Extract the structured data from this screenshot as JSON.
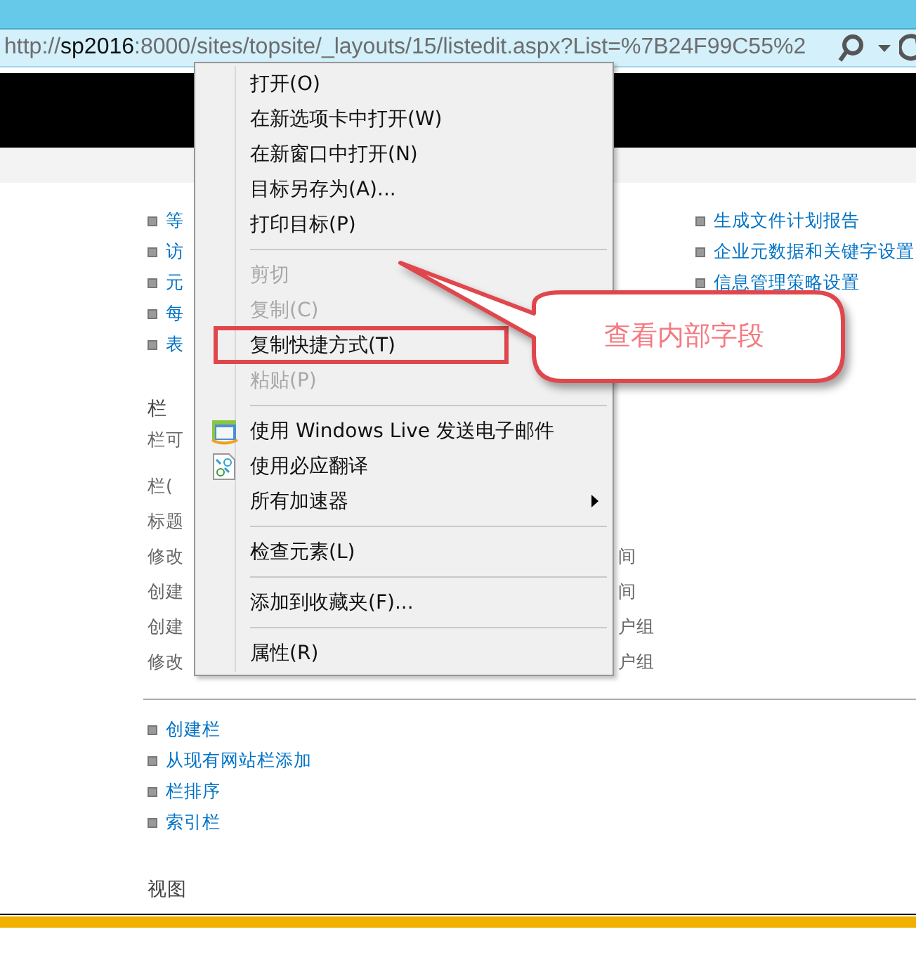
{
  "address_bar": {
    "scheme": "http://",
    "host": "sp2016",
    "path": ":8000/sites/topsite/_layouts/15/listedit.aspx?List=%7B24F99C55%2"
  },
  "left_links": [
    "等",
    "访",
    "元",
    "每",
    "表"
  ],
  "right_links": [
    "生成文件计划报告",
    "企业元数据和关键字设置",
    "信息管理策略设置"
  ],
  "columns_section": {
    "heading": "栏",
    "description": "栏可",
    "rows": [
      {
        "name": "栏("
      },
      {
        "name": "标题"
      },
      {
        "name": "修改",
        "type": "间"
      },
      {
        "name": "创建",
        "type": "间"
      },
      {
        "name": "创建",
        "type": "户组"
      },
      {
        "name": "修改",
        "type": "户组"
      }
    ]
  },
  "column_actions": [
    "创建栏",
    "从现有网站栏添加",
    "栏排序",
    "索引栏"
  ],
  "views_heading": "视图",
  "context_menu": {
    "items": [
      {
        "kind": "item",
        "label": "打开(O)",
        "disabled": false
      },
      {
        "kind": "item",
        "label": "在新选项卡中打开(W)",
        "disabled": false
      },
      {
        "kind": "item",
        "label": "在新窗口中打开(N)",
        "disabled": false
      },
      {
        "kind": "item",
        "label": "目标另存为(A)...",
        "disabled": false
      },
      {
        "kind": "item",
        "label": "打印目标(P)",
        "disabled": false
      },
      {
        "kind": "separator"
      },
      {
        "kind": "item",
        "label": "剪切",
        "disabled": true
      },
      {
        "kind": "item",
        "label": "复制(C)",
        "disabled": true
      },
      {
        "kind": "item",
        "label": "复制快捷方式(T)",
        "disabled": false
      },
      {
        "kind": "item",
        "label": "粘贴(P)",
        "disabled": true
      },
      {
        "kind": "separator"
      },
      {
        "kind": "email",
        "label": "使用 Windows Live 发送电子邮件",
        "disabled": false
      },
      {
        "kind": "translate",
        "label": "使用必应翻译",
        "disabled": false
      },
      {
        "kind": "submenu",
        "label": "所有加速器",
        "disabled": false
      },
      {
        "kind": "separator"
      },
      {
        "kind": "item",
        "label": "检查元素(L)",
        "disabled": false
      },
      {
        "kind": "separator"
      },
      {
        "kind": "item",
        "label": "添加到收藏夹(F)...",
        "disabled": false
      },
      {
        "kind": "separator"
      },
      {
        "kind": "item",
        "label": "属性(R)",
        "disabled": false
      }
    ]
  },
  "annotation": {
    "text": "查看内部字段"
  }
}
